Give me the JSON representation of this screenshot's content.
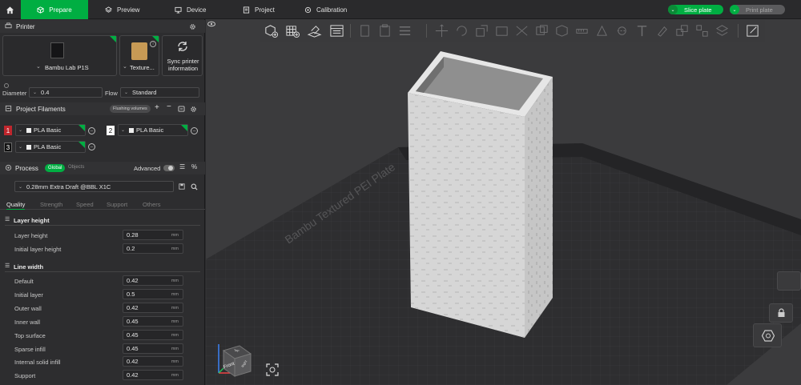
{
  "topbar": {
    "tabs": [
      {
        "label": "Prepare",
        "icon": "cube-outline-icon",
        "active": true
      },
      {
        "label": "Preview",
        "icon": "layers-icon",
        "active": false
      },
      {
        "label": "Device",
        "icon": "monitor-icon",
        "active": false
      },
      {
        "label": "Project",
        "icon": "document-icon",
        "active": false
      },
      {
        "label": "Calibration",
        "icon": "target-icon",
        "active": false
      }
    ],
    "slice_label": "Slice plate",
    "print_label": "Print plate"
  },
  "printer": {
    "section_title": "Printer",
    "name": "Bambu Lab P1S",
    "plate": "Texture...",
    "sync_label_1": "Sync printer",
    "sync_label_2": "information",
    "diameter_label": "Diameter",
    "diameter_value": "0.4",
    "flow_label": "Flow",
    "flow_value": "Standard"
  },
  "filaments": {
    "section_title": "Project Filaments",
    "flushing_label": "Flushing volumes",
    "items": [
      {
        "num": "1",
        "name": "PLA Basic",
        "num_color": "#c0262d"
      },
      {
        "num": "2",
        "name": "PLA Basic",
        "num_color": "#ffffff"
      },
      {
        "num": "3",
        "name": "PLA Basic",
        "num_color": "#111111"
      }
    ]
  },
  "process": {
    "section_title": "Process",
    "global_label": "Global",
    "objects_label": "Objects",
    "advanced_label": "Advanced",
    "preset": "0.28mm Extra Draft @BBL X1C",
    "tabs": [
      "Quality",
      "Strength",
      "Speed",
      "Support",
      "Others"
    ],
    "groups": [
      {
        "title": "Layer height",
        "rows": [
          {
            "label": "Layer height",
            "value": "0.28",
            "unit": "mm"
          },
          {
            "label": "Initial layer height",
            "value": "0.2",
            "unit": "mm"
          }
        ]
      },
      {
        "title": "Line width",
        "rows": [
          {
            "label": "Default",
            "value": "0.42",
            "unit": "mm"
          },
          {
            "label": "Initial layer",
            "value": "0.5",
            "unit": "mm"
          },
          {
            "label": "Outer wall",
            "value": "0.42",
            "unit": "mm"
          },
          {
            "label": "Inner wall",
            "value": "0.45",
            "unit": "mm"
          },
          {
            "label": "Top surface",
            "value": "0.45",
            "unit": "mm"
          },
          {
            "label": "Sparse infill",
            "value": "0.45",
            "unit": "mm"
          },
          {
            "label": "Internal solid infill",
            "value": "0.42",
            "unit": "mm"
          },
          {
            "label": "Support",
            "value": "0.42",
            "unit": "mm"
          }
        ]
      }
    ]
  },
  "viewport": {
    "plate_label": "Bambu Textured PEI Plate",
    "cube_labels": {
      "front": "Front",
      "top": "Top",
      "right": "Right"
    }
  },
  "colors": {
    "accent": "#00ae42",
    "panel": "#2d2d2f",
    "bed": "#2f2f31",
    "model": "#d9d9d9"
  }
}
